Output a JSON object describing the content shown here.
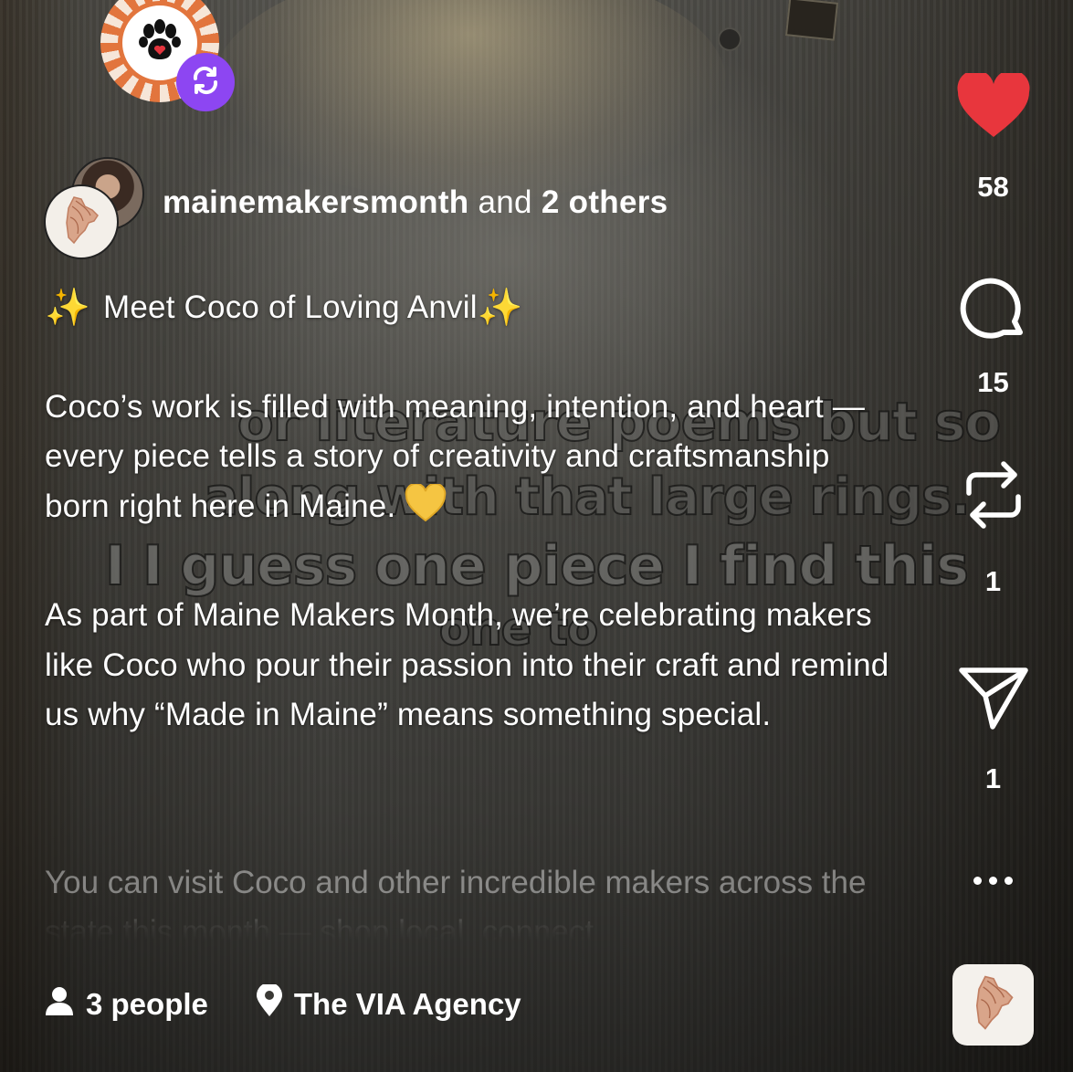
{
  "profile": {
    "avatar_icon": "paw-heart-icon",
    "badge_icon": "repost-badge-icon",
    "badge_color": "#8D46F2"
  },
  "authors": {
    "primary": "mainemakersmonth",
    "connector": "and",
    "others": "2 others"
  },
  "post": {
    "headline_sparkle_left": "✨",
    "headline": "Meet Coco of Loving Anvil",
    "headline_sparkle_right": "✨",
    "paragraph1": "Coco’s work is filled with meaning, intention, and heart — every piece tells a story of creativity and craftsmanship born right here in Maine.",
    "paragraph2": "As part of Maine Makers Month, we’re celebrating makers like Coco who pour their passion into their craft and remind us why “Made in Maine” means something special.",
    "paragraph3": "You can visit Coco and other incredible makers across the state this month — shop local, connect"
  },
  "video_captions": {
    "line1": "or literature poems but so",
    "line2": "along with that large rings.",
    "line3": "I I guess one piece I find this",
    "line4": "one to"
  },
  "actions": {
    "like_count": "58",
    "comment_count": "15",
    "repost_count": "1",
    "share_count": "1",
    "like_color": "#E8363D"
  },
  "footer": {
    "people_label": "3 people",
    "location_label": "The VIA Agency"
  }
}
